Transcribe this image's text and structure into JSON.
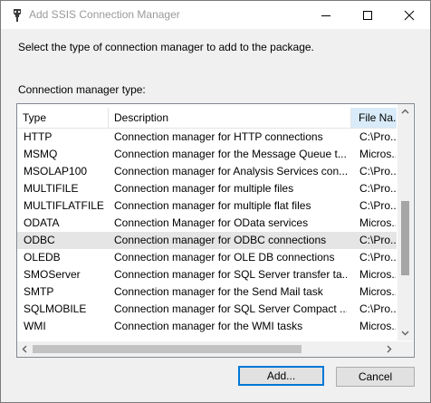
{
  "window": {
    "title": "Add SSIS Connection Manager",
    "icon": "ssis-connector-icon",
    "controls": [
      "minimize-icon",
      "maximize-icon",
      "close-icon"
    ]
  },
  "instruction": "Select the type of connection manager to add to the package.",
  "list_label": "Connection manager type:",
  "columns": {
    "type": "Type",
    "description": "Description",
    "file": "File Na..."
  },
  "rows": [
    {
      "type": "HTTP",
      "description": "Connection manager for HTTP connections",
      "file": "C:\\Pro..."
    },
    {
      "type": "MSMQ",
      "description": "Connection manager for the Message Queue t...",
      "file": "Micros..."
    },
    {
      "type": "MSOLAP100",
      "description": "Connection manager for Analysis Services con...",
      "file": "C:\\Pro..."
    },
    {
      "type": "MULTIFILE",
      "description": "Connection manager for multiple files",
      "file": "C:\\Pro..."
    },
    {
      "type": "MULTIFLATFILE",
      "description": "Connection manager for multiple flat files",
      "file": "C:\\Pro..."
    },
    {
      "type": "ODATA",
      "description": "Connection Manager for OData services",
      "file": "Micros..."
    },
    {
      "type": "ODBC",
      "description": "Connection manager for ODBC connections",
      "file": "C:\\Pro...",
      "selected": true
    },
    {
      "type": "OLEDB",
      "description": "Connection manager for OLE DB connections",
      "file": "C:\\Pro..."
    },
    {
      "type": "SMOServer",
      "description": "Connection manager for SQL Server transfer ta...",
      "file": "Micros..."
    },
    {
      "type": "SMTP",
      "description": "Connection manager for the Send Mail task",
      "file": "Micros..."
    },
    {
      "type": "SQLMOBILE",
      "description": "Connection manager for SQL Server Compact ...",
      "file": "C:\\Pro..."
    },
    {
      "type": "WMI",
      "description": "Connection manager for the WMI tasks",
      "file": "Micros..."
    }
  ],
  "vertical_scroll": {
    "position": 0.62,
    "visible_fraction": 0.36
  },
  "horizontal_scroll": {
    "position": 0.0,
    "visible_fraction": 0.77
  },
  "buttons": {
    "add": "Add...",
    "cancel": "Cancel"
  },
  "colors": {
    "accent": "#0078d7",
    "selected_row": "#e5e5e5",
    "sorted_header": "#d9ebf9"
  }
}
